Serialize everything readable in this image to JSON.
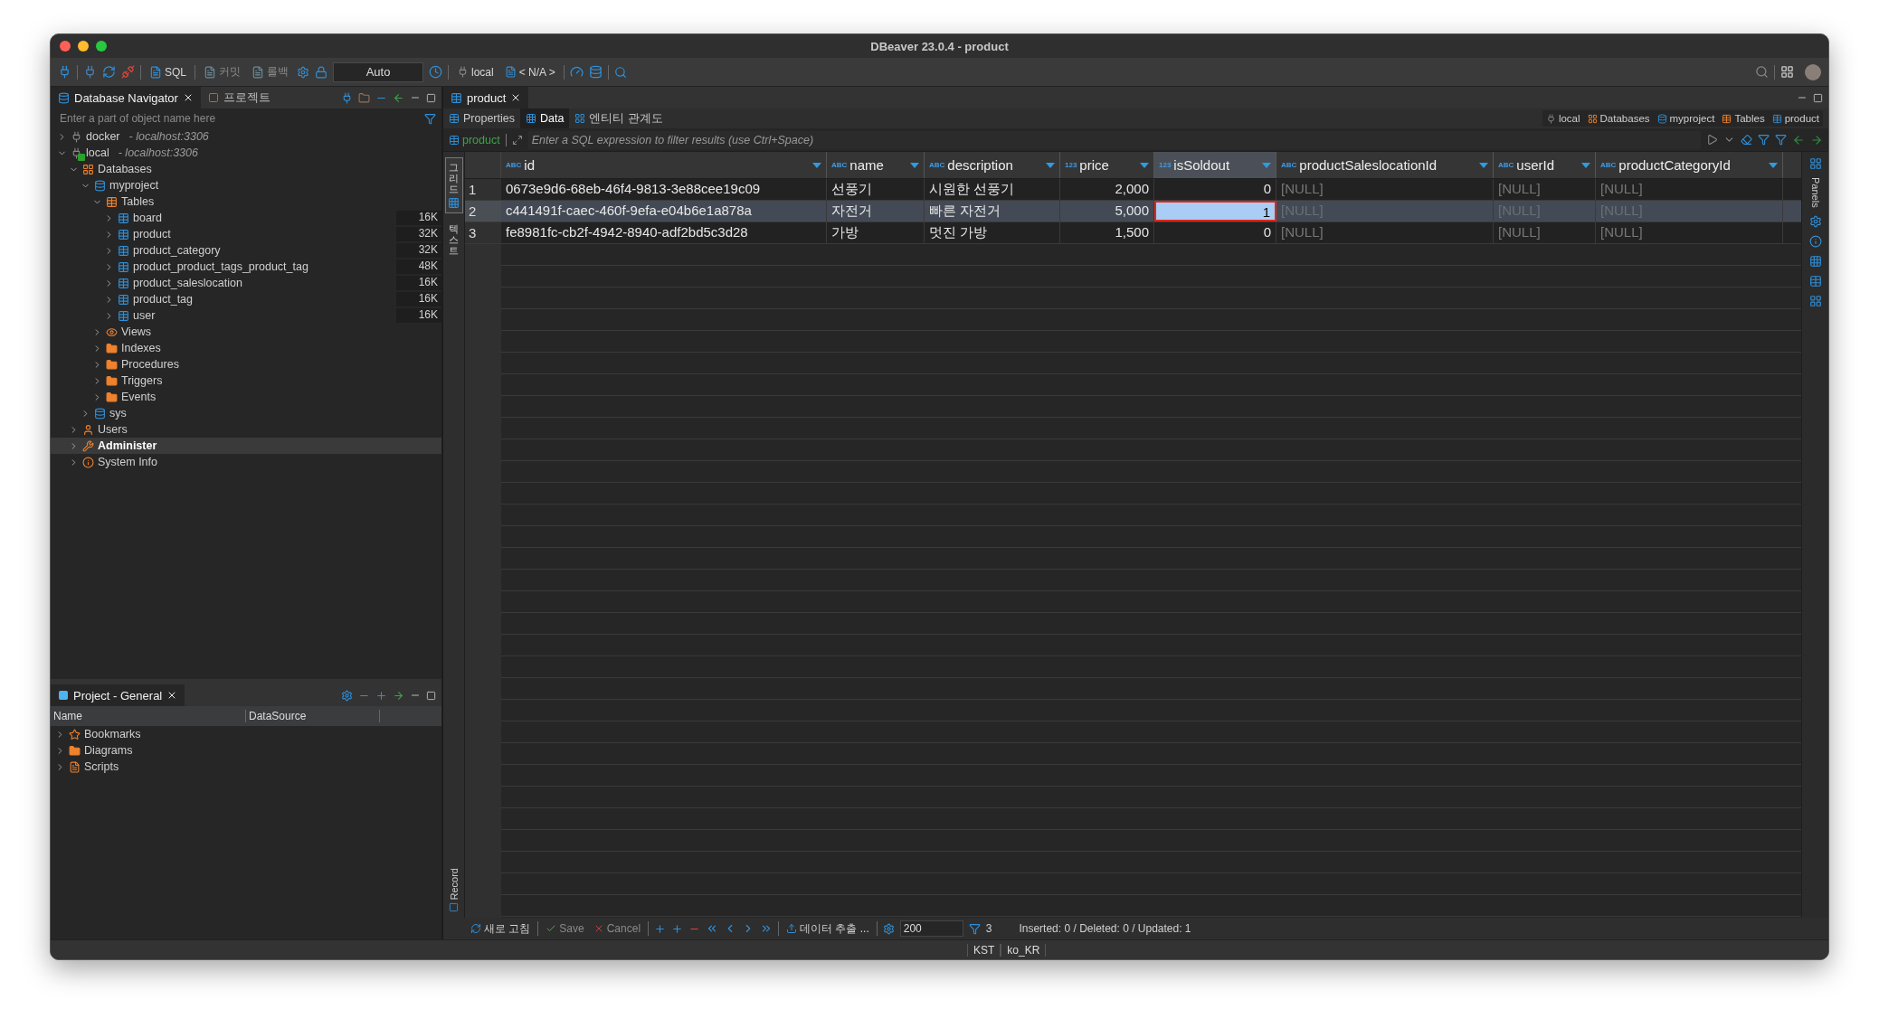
{
  "window": {
    "title": "DBeaver 23.0.4 - product"
  },
  "toolbar": {
    "sql": "SQL",
    "commit": "커밋",
    "rollback": "롤백",
    "transaction_mode": "Auto",
    "datasource": "local",
    "schema": "< N/A >"
  },
  "navigator": {
    "tabs": [
      {
        "label": "Database Navigator",
        "selected": true
      },
      {
        "label": "프로젝트",
        "selected": false
      }
    ],
    "filter": {
      "placeholder": "Enter a part of object name here"
    },
    "tree": [
      {
        "label": "docker",
        "detail": "- localhost:3306",
        "kind": "connection",
        "connected": false,
        "expanded": false,
        "selected": false
      },
      {
        "label": "local",
        "detail": "- localhost:3306",
        "kind": "connection",
        "connected": true,
        "expanded": true,
        "selected": false,
        "children": [
          {
            "label": "Databases",
            "kind": "databases",
            "expanded": true,
            "selected": false,
            "children": [
              {
                "label": "myproject",
                "kind": "database",
                "expanded": true,
                "selected": false,
                "children": [
                  {
                    "label": "Tables",
                    "kind": "tables",
                    "expanded": true,
                    "selected": false,
                    "children": [
                      {
                        "label": "board",
                        "kind": "table",
                        "size": "16K",
                        "expanded": false,
                        "selected": false
                      },
                      {
                        "label": "product",
                        "kind": "table",
                        "size": "32K",
                        "expanded": false,
                        "selected": false
                      },
                      {
                        "label": "product_category",
                        "kind": "table",
                        "size": "32K",
                        "expanded": false,
                        "selected": false
                      },
                      {
                        "label": "product_product_tags_product_tag",
                        "kind": "table",
                        "size": "48K",
                        "expanded": false,
                        "selected": false
                      },
                      {
                        "label": "product_saleslocation",
                        "kind": "table",
                        "size": "16K",
                        "expanded": false,
                        "selected": false
                      },
                      {
                        "label": "product_tag",
                        "kind": "table",
                        "size": "16K",
                        "expanded": false,
                        "selected": false
                      },
                      {
                        "label": "user",
                        "kind": "table",
                        "size": "16K",
                        "expanded": false,
                        "selected": false
                      }
                    ]
                  },
                  {
                    "label": "Views",
                    "kind": "views",
                    "expanded": false,
                    "selected": false
                  },
                  {
                    "label": "Indexes",
                    "kind": "folder",
                    "expanded": false,
                    "selected": false
                  },
                  {
                    "label": "Procedures",
                    "kind": "folder",
                    "expanded": false,
                    "selected": false
                  },
                  {
                    "label": "Triggers",
                    "kind": "folder",
                    "expanded": false,
                    "selected": false
                  },
                  {
                    "label": "Events",
                    "kind": "folder",
                    "expanded": false,
                    "selected": false
                  }
                ]
              },
              {
                "label": "sys",
                "kind": "database",
                "expanded": false,
                "selected": false
              }
            ]
          },
          {
            "label": "Users",
            "kind": "users",
            "expanded": false,
            "selected": false
          },
          {
            "label": "Administer",
            "kind": "administer",
            "expanded": false,
            "selected": true
          },
          {
            "label": "System Info",
            "kind": "info",
            "expanded": false,
            "selected": false
          }
        ]
      }
    ]
  },
  "project": {
    "title": "Project - General",
    "columns": [
      "Name",
      "DataSource"
    ],
    "items": [
      {
        "label": "Bookmarks",
        "kind": "bookmarks"
      },
      {
        "label": "Diagrams",
        "kind": "diagrams"
      },
      {
        "label": "Scripts",
        "kind": "scripts"
      }
    ]
  },
  "editor": {
    "tab": "product",
    "subtabs": [
      {
        "label": "Properties",
        "selected": false
      },
      {
        "label": "Data",
        "selected": true
      },
      {
        "label": "엔티티 관계도",
        "selected": false
      }
    ],
    "breadcrumb": [
      "local",
      "Databases",
      "myproject",
      "Tables",
      "product"
    ],
    "filter": {
      "entity": "product",
      "placeholder": "Enter a SQL expression to filter results (use Ctrl+Space)"
    },
    "side_tabs": [
      {
        "label": "그리드",
        "selected": true
      },
      {
        "label": "텍스트",
        "selected": false
      }
    ],
    "record_label": "Record",
    "columns": [
      {
        "name": "id",
        "type": "ABC",
        "kind": "text",
        "selected": false
      },
      {
        "name": "name",
        "type": "ABC",
        "kind": "text",
        "selected": false
      },
      {
        "name": "description",
        "type": "ABC",
        "kind": "text",
        "selected": false
      },
      {
        "name": "price",
        "type": "123",
        "kind": "number",
        "selected": false
      },
      {
        "name": "isSoldout",
        "type": "123",
        "kind": "number",
        "selected": true
      },
      {
        "name": "productSaleslocationId",
        "type": "ABC",
        "kind": "text",
        "selected": false
      },
      {
        "name": "userId",
        "type": "ABC",
        "kind": "text",
        "selected": false
      },
      {
        "name": "productCategoryId",
        "type": "ABC",
        "kind": "text",
        "selected": false
      }
    ],
    "rows": [
      {
        "number": "1",
        "selected": false,
        "cells": [
          {
            "value": "0673e9d6-68eb-46f4-9813-3e88cee19c09",
            "null": false,
            "editing": false
          },
          {
            "value": "선풍기",
            "null": false,
            "editing": false
          },
          {
            "value": "시원한 선풍기",
            "null": false,
            "editing": false
          },
          {
            "value": "2,000",
            "null": false,
            "editing": false
          },
          {
            "value": "0",
            "null": false,
            "editing": false
          },
          {
            "value": "[NULL]",
            "null": true,
            "editing": false
          },
          {
            "value": "[NULL]",
            "null": true,
            "editing": false
          },
          {
            "value": "[NULL]",
            "null": true,
            "editing": false
          }
        ]
      },
      {
        "number": "2",
        "selected": true,
        "cells": [
          {
            "value": "c441491f-caec-460f-9efa-e04b6e1a878a",
            "null": false,
            "editing": false
          },
          {
            "value": "자전거",
            "null": false,
            "editing": false
          },
          {
            "value": "빠른 자전거",
            "null": false,
            "editing": false
          },
          {
            "value": "5,000",
            "null": false,
            "editing": false
          },
          {
            "value": "1",
            "null": false,
            "editing": true
          },
          {
            "value": "[NULL]",
            "null": true,
            "editing": false
          },
          {
            "value": "[NULL]",
            "null": true,
            "editing": false
          },
          {
            "value": "[NULL]",
            "null": true,
            "editing": false
          }
        ]
      },
      {
        "number": "3",
        "selected": false,
        "cells": [
          {
            "value": "fe8981fc-cb2f-4942-8940-adf2bd5c3d28",
            "null": false,
            "editing": false
          },
          {
            "value": "가방",
            "null": false,
            "editing": false
          },
          {
            "value": "멋진 가방",
            "null": false,
            "editing": false
          },
          {
            "value": "1,500",
            "null": false,
            "editing": false
          },
          {
            "value": "0",
            "null": false,
            "editing": false
          },
          {
            "value": "[NULL]",
            "null": true,
            "editing": false
          },
          {
            "value": "[NULL]",
            "null": true,
            "editing": false
          },
          {
            "value": "[NULL]",
            "null": true,
            "editing": false
          }
        ]
      }
    ],
    "panels_label": "Panels",
    "bottom_toolbar": {
      "refresh": "새로 고침",
      "save": "Save",
      "cancel": "Cancel",
      "export": "데이터 추출 ...",
      "fetch_size": "200",
      "row_count": "3",
      "status": "Inserted: 0 / Deleted: 0 / Updated: 1"
    }
  },
  "status_bar": {
    "timezone": "KST",
    "locale": "ko_KR"
  }
}
